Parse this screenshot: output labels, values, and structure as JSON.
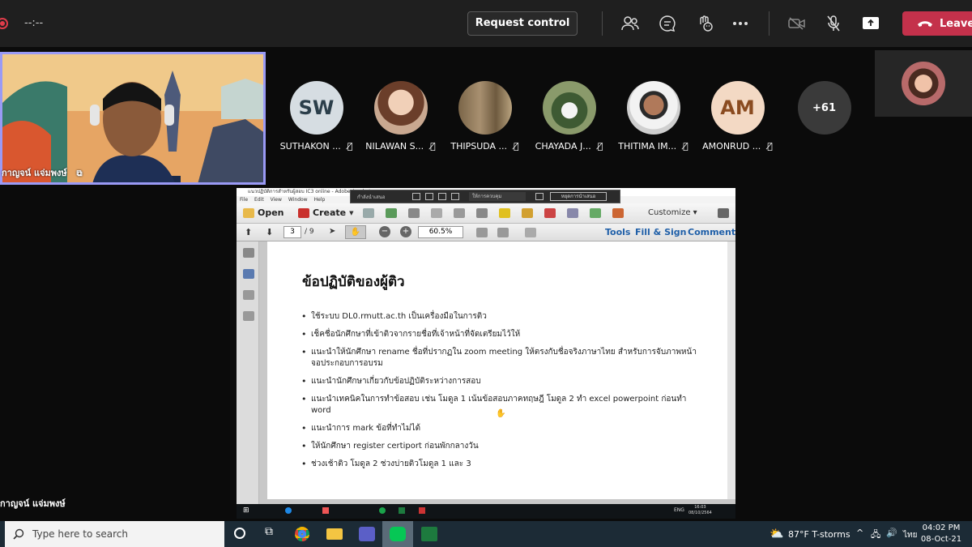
{
  "call": {
    "timer": "--:--",
    "request_control_label": "Request control",
    "leave_label": "Leave"
  },
  "presenter": {
    "name": "กาญจน์ แจ่มพงษ์"
  },
  "bottom_left_name": "กาญจน์ แจ่มพงษ์",
  "participants": [
    {
      "name": "SUTHAKON ...",
      "initials": "SW",
      "bg": "#d6dde2",
      "fg": "#2b3e4a"
    },
    {
      "name": "NILAWAN S...",
      "initials": "",
      "bg": "#b89a86",
      "fg": "#fff"
    },
    {
      "name": "THIPSUDA ...",
      "initials": "",
      "bg": "#9c8a6c",
      "fg": "#fff"
    },
    {
      "name": "CHAYADA J...",
      "initials": "",
      "bg": "#6f7d5c",
      "fg": "#fff"
    },
    {
      "name": "THITIMA IM...",
      "initials": "",
      "bg": "#a8a8a8",
      "fg": "#fff"
    },
    {
      "name": "AMONRUD ...",
      "initials": "AM",
      "bg": "#f3d9c4",
      "fg": "#8a4b20"
    }
  ],
  "more_count": "+61",
  "acrobat": {
    "title": "แนวปฏิบัติการสำหรับผู้สอบ IC3 online - Adobe Acrobat",
    "menu": [
      "File",
      "Edit",
      "View",
      "Window",
      "Help"
    ],
    "open_label": "Open",
    "create_label": "Create",
    "customize_label": "Customize",
    "page_current": "3",
    "page_total": "/ 9",
    "zoom": "60.5%",
    "tools_label": "Tools",
    "fill_sign_label": "Fill & Sign",
    "comment_label": "Comment"
  },
  "document": {
    "title": "ข้อปฏิบัติของผู้ติว",
    "items": [
      "ใช้ระบบ DL0.rmutt.ac.th เป็นเครื่องมือในการติว",
      "เช็คชื่อนักศึกษาที่เข้าติวจากรายชื่อที่เจ้าหน้าที่จัดเตรียมไว้ให้",
      "แนะนำให้นักศึกษา rename ชื่อที่ปรากฏใน zoom meeting ให้ตรงกับชื่อจริงภาษาไทย สำหรับการจับภาพหน้าจอประกอบการอบรม",
      "แนะนำนักศึกษาเกี่ยวกับข้อปฏิบัติระหว่างการสอบ",
      "แนะนำเทคนิคในการทำข้อสอบ เช่น โมดูล 1 เน้นข้อสอบภาคทฤษฎี โมดูล 2 ทำ excel powerpoint ก่อนทำ word",
      "แนะนำการ mark ข้อที่ทำไม่ได้",
      "ให้นักศึกษา register certiport ก่อนพักกลางวัน",
      "ช่วงเช้าติว โมดูล 2 ช่วงบ่ายติวโมดูล 1 และ 3"
    ]
  },
  "share_bar": {
    "sharing_label": "กำลังนำเสนอ",
    "select_label": "ให้การควบคุม",
    "stop_label": "หยุดการนำเสนอ"
  },
  "inner_taskbar": {
    "lang": "ENG",
    "time": "16:03",
    "date": "08/10/2564"
  },
  "taskbar": {
    "search_placeholder": "Type here to search",
    "weather": "87°F  T-storms",
    "lang": "ไทย",
    "time": "04:02 PM",
    "date": "08-Oct-21"
  },
  "colors": {
    "leave": "#c4314b",
    "presenter_border": "#9a9af5",
    "accent_link": "#1f5fa8"
  }
}
